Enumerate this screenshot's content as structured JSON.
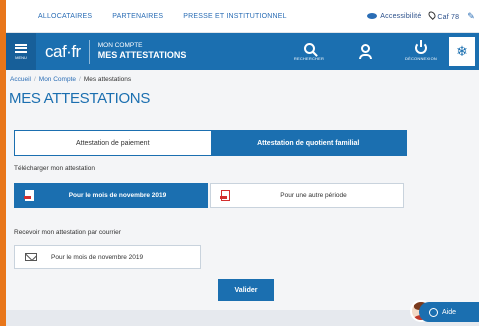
{
  "topbar": {
    "links": [
      "ALLOCATAIRES",
      "PARTENAIRES",
      "PRESSE ET INSTITUTIONNEL"
    ],
    "accessibility": "Accessibilité",
    "caf": "Caf 78"
  },
  "header": {
    "menu_label": "MENU",
    "logo": "caf·fr",
    "subtitle": "MON COMPTE",
    "title": "MES ATTESTATIONS",
    "search_label": "RECHERCHER",
    "logout_label": "DÉCONNEXION"
  },
  "breadcrumb": {
    "items": [
      "Accueil",
      "Mon Compte"
    ],
    "current": "Mes attestations"
  },
  "page_title": "MES ATTESTATIONS",
  "tabs": [
    "Attestation de paiement",
    "Attestation de quotient familial"
  ],
  "download": {
    "label": "Télécharger mon attestation",
    "options": [
      "Pour le mois de novembre 2019",
      "Pour une autre période"
    ]
  },
  "mail": {
    "label": "Recevoir mon attestation par courrier",
    "option": "Pour le mois de novembre 2019"
  },
  "validate_label": "Valider",
  "help_label": "Aide",
  "colors": {
    "primary": "#1b6fb0",
    "border": "#e8761a"
  }
}
